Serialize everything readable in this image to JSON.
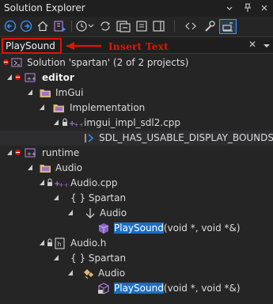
{
  "window": {
    "title": "Solution Explorer",
    "dropdown_icon": "chevron-down-icon",
    "pin_icon": "pin-icon",
    "close_icon": "close-icon"
  },
  "search": {
    "value": "PlaySound",
    "clear_glyph": "✕",
    "annotation": "Insert Text"
  },
  "tree": {
    "solution": "Solution 'spartan' (2 of 2 projects)",
    "editor": "editor",
    "imgui": "ImGui",
    "implementation": "Implementation",
    "imgui_file": "imgui_impl_sdl2.cpp",
    "sdl_macro": "SDL_HAS_USABLE_DISPLAY_BOUNDS",
    "runtime": "runtime",
    "audio_folder": "Audio",
    "audio_cpp": "Audio.cpp",
    "spartan_ns_1": "{ } Spartan",
    "audio_class_1": "Audio",
    "playsound_1": "PlaySound",
    "playsound_1_params": "(void *, void *&)",
    "audio_h": "Audio.h",
    "spartan_ns_2": "{ } Spartan",
    "audio_class_2": "Audio",
    "playsound_2": "PlaySound",
    "playsound_2_params": "(void *, void *&)"
  },
  "colors": {
    "accent_red": "#e51400",
    "highlight_blue": "#1a6dc6",
    "folder_yellow": "#dcb67a"
  }
}
